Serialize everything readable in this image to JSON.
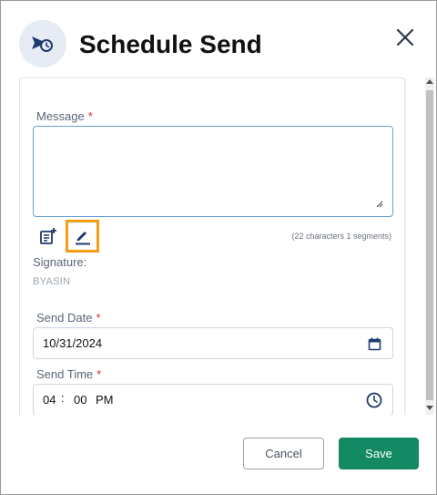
{
  "dialog": {
    "title": "Schedule Send",
    "close_icon": "close-icon",
    "header_icon": "send-clock-icon"
  },
  "form": {
    "message": {
      "label": "Message",
      "required_mark": "*",
      "value": ""
    },
    "tools": {
      "insert_template_icon": "insert-template-icon",
      "edit_signature_icon": "pencil-icon",
      "char_count": "(22 characters 1 segments)"
    },
    "signature": {
      "label": "Signature:",
      "value": "BYASIN"
    },
    "send_date": {
      "label": "Send Date",
      "required_mark": "*",
      "value": "10/31/2024",
      "icon": "calendar-icon"
    },
    "send_time": {
      "label": "Send Time",
      "required_mark": "*",
      "hour": "04",
      "separator": ":",
      "minute": "00",
      "period": "PM",
      "icon": "clock-icon"
    }
  },
  "footer": {
    "cancel_label": "Cancel",
    "save_label": "Save"
  },
  "colors": {
    "accent": "#138a63",
    "highlight": "#f39c12",
    "required": "#d32f2f",
    "header_icon_bg": "#e7ecf4",
    "icon_navy": "#1e3a6e"
  }
}
